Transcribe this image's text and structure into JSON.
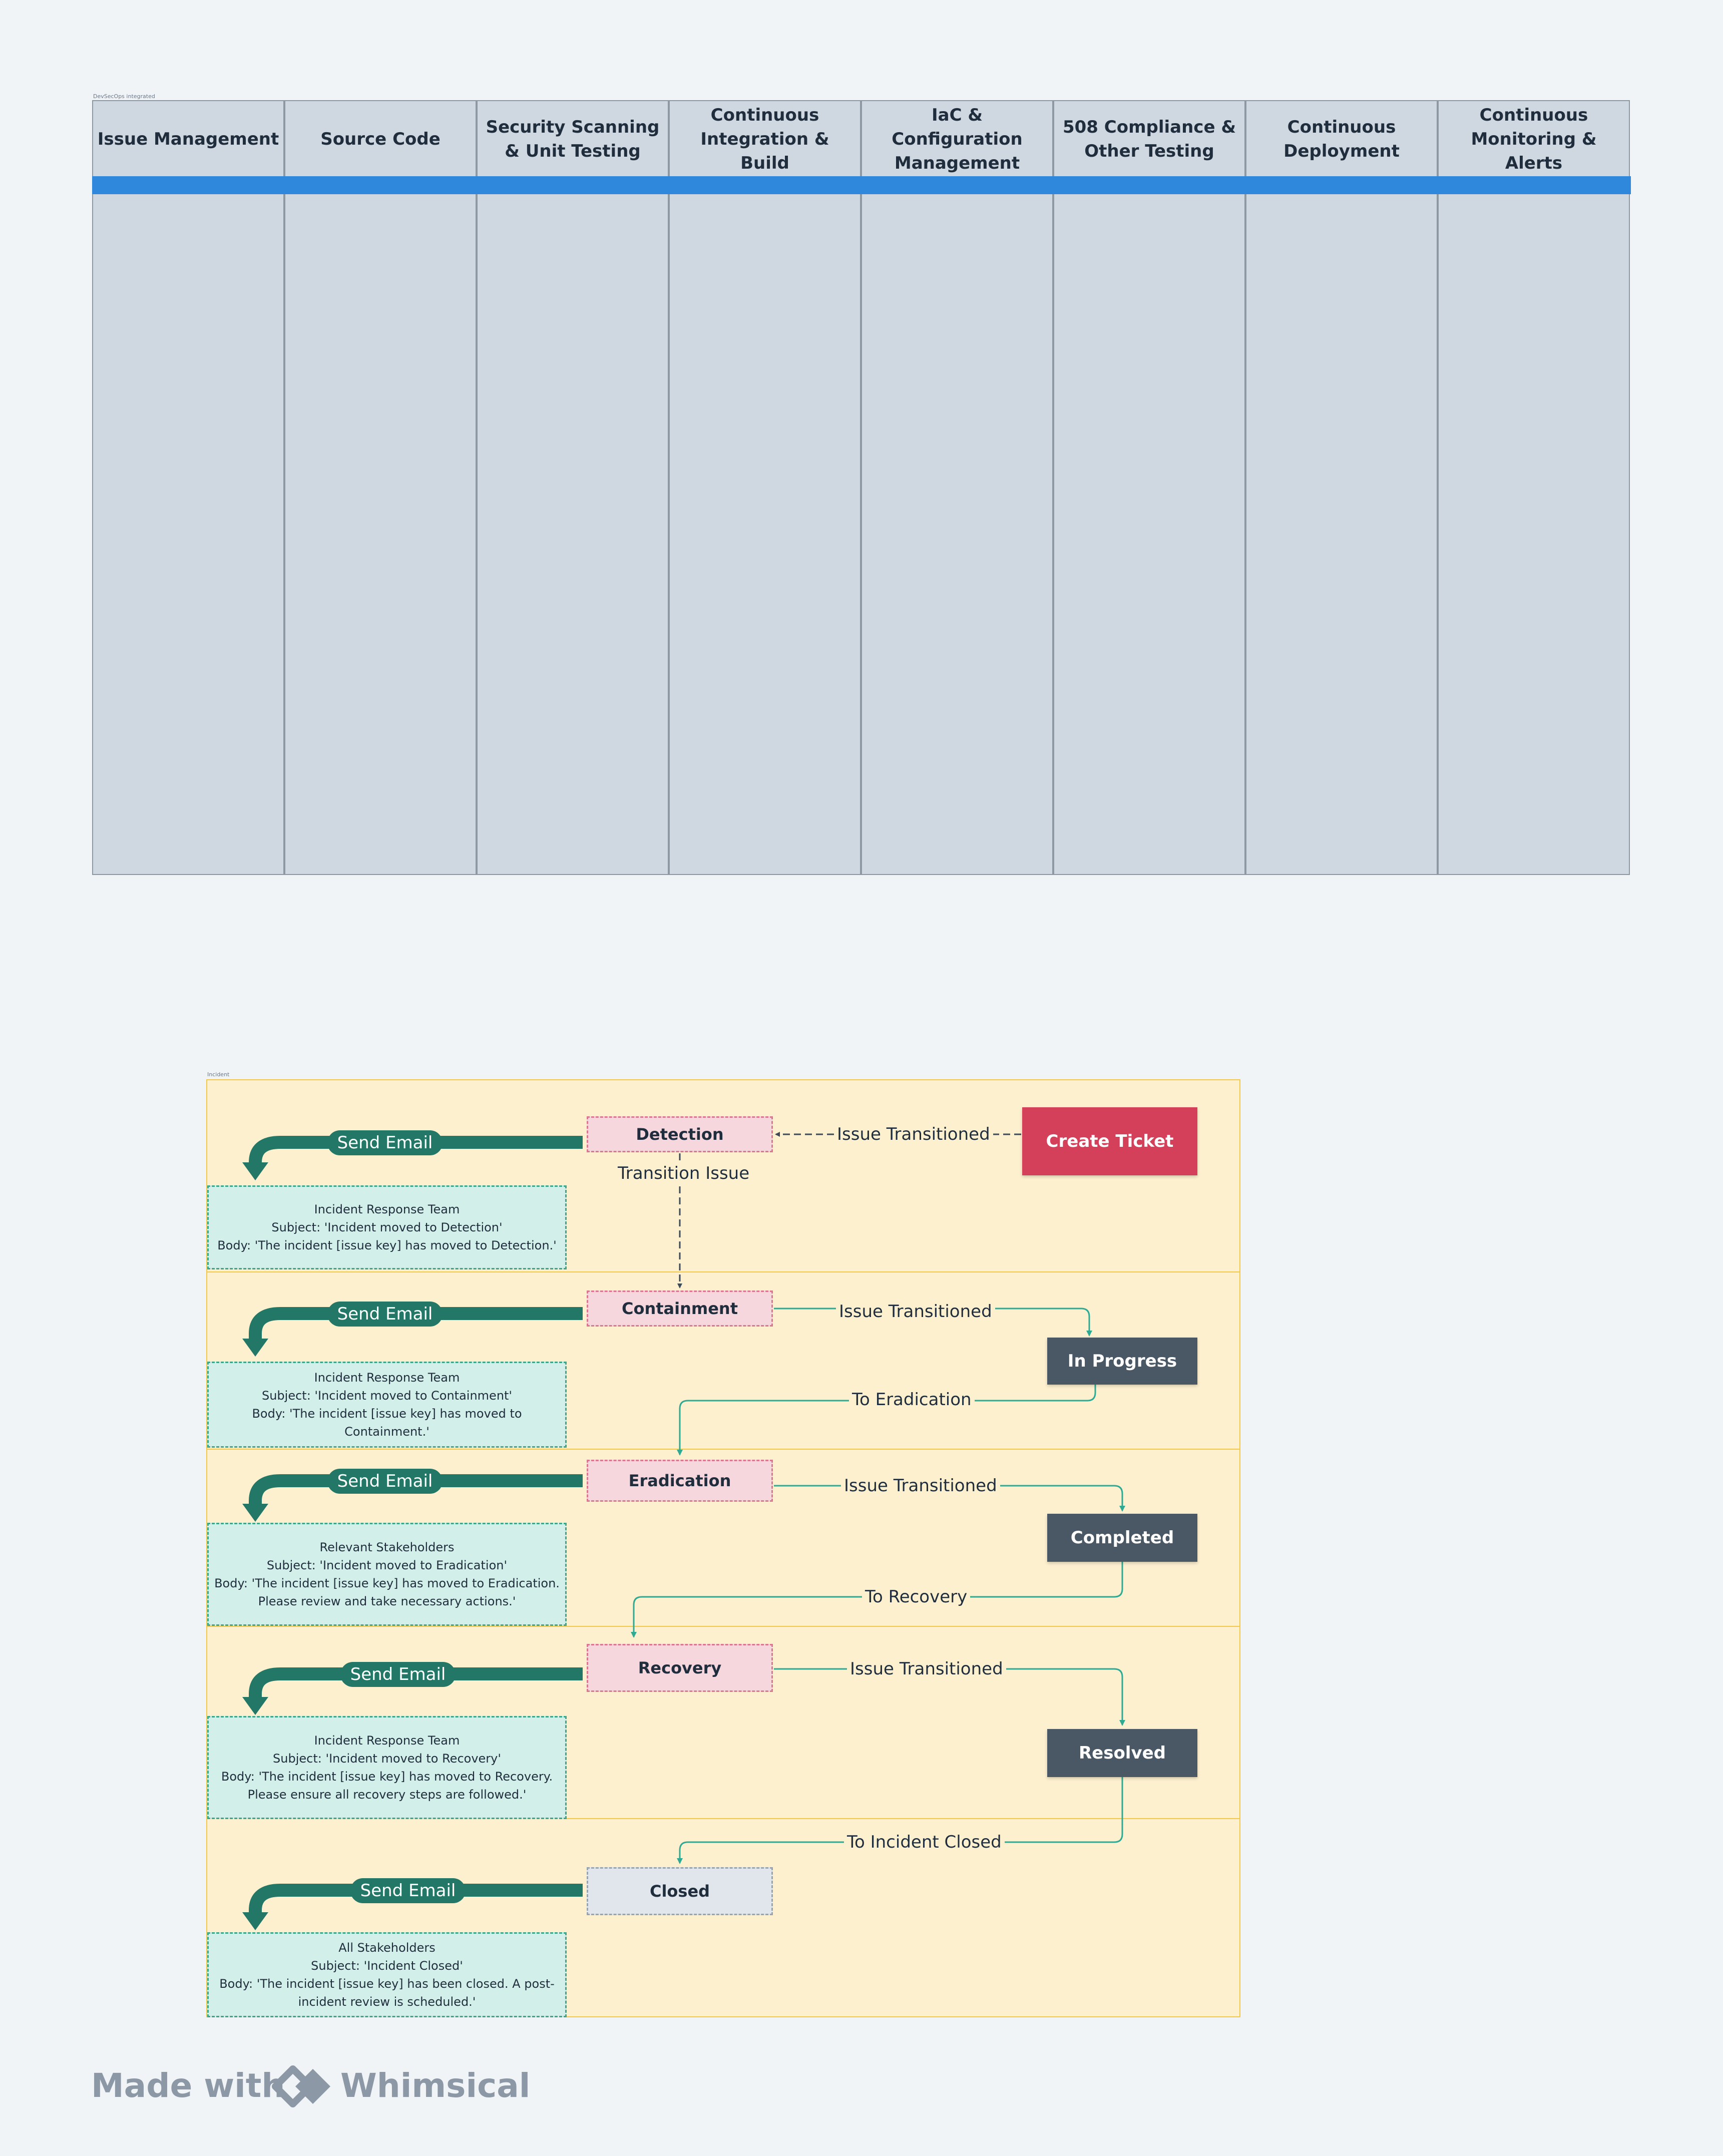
{
  "devsecops": {
    "frame_label": "DevSecOps integrated",
    "columns": [
      "Issue Management",
      "Source Code",
      "Security Scanning & Unit Testing",
      "Continuous Integration & Build",
      "IaC & Configuration Management",
      "508 Compliance & Other Testing",
      "Continuous Deployment",
      "Continuous Monitoring & Alerts"
    ]
  },
  "incident": {
    "frame_label": "Incident",
    "stages": {
      "detection": "Detection",
      "containment": "Containment",
      "eradication": "Eradication",
      "recovery": "Recovery",
      "closed": "Closed"
    },
    "statuses": {
      "create_ticket": "Create Ticket",
      "in_progress": "In Progress",
      "completed": "Completed",
      "resolved": "Resolved"
    },
    "edge_labels": {
      "issue_transitioned": "Issue Transitioned",
      "transition_issue": "Transition Issue",
      "to_eradication": "To Eradication",
      "to_recovery": "To Recovery",
      "to_incident_closed": "To Incident Closed"
    },
    "send_email_label": "Send Email",
    "emails": {
      "detection": [
        "Incident Response Team",
        "Subject: 'Incident moved to Detection'",
        "Body: 'The incident [issue key] has moved to Detection.'"
      ],
      "containment": [
        "Incident Response Team",
        "Subject: 'Incident moved to Containment'",
        "Body: 'The incident [issue key] has moved to Containment.'"
      ],
      "eradication": [
        "Relevant Stakeholders",
        "Subject: 'Incident moved to Eradication'",
        "Body: 'The incident [issue key] has moved to Eradication.",
        "Please review and take necessary actions.'"
      ],
      "recovery": [
        "Incident Response Team",
        "Subject: 'Incident moved to Recovery'",
        "Body: 'The incident [issue key] has moved to Recovery.",
        "Please ensure all recovery steps are followed.'"
      ],
      "closed": [
        "All Stakeholders",
        "Subject: 'Incident Closed'",
        "Body: 'The incident [issue key] has been closed. A post-",
        "incident review is scheduled.'"
      ]
    }
  },
  "footer": {
    "made_with": "Made with",
    "brand": "Whimsical"
  },
  "colors": {
    "column_fill": "#cfd8e1",
    "header_bar": "#2f88dc",
    "band_fill": "#fdf0cf",
    "band_border": "#f3c84b",
    "stage_fill": "#f7d7de",
    "status_fill": "#4a5866",
    "create_ticket": "#d43f5a",
    "email_fill": "#d2efe9",
    "send_email_arrow": "#237766",
    "connector": "#2eaa94"
  }
}
